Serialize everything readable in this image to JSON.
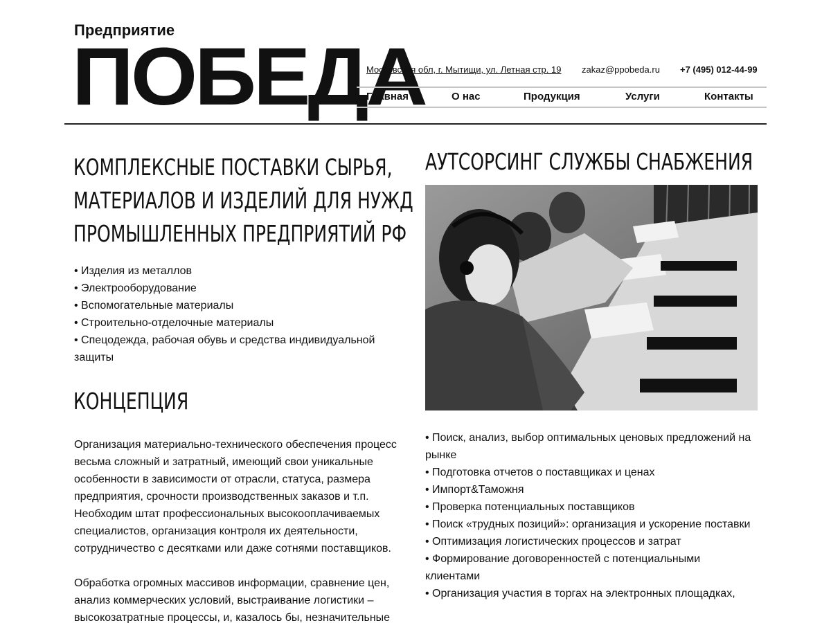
{
  "header": {
    "brand_small": "Предприятие",
    "brand_big": "ПОБЕДА",
    "address": "Московская обл, г. Мытищи, ул. Летная стр. 19",
    "email": "zakaz@ppobeda.ru",
    "phone": "+7 (495) 012-44-99"
  },
  "nav": {
    "items": [
      "Главная",
      "О нас",
      "Продукция",
      "Услуги",
      "Контакты"
    ]
  },
  "hero": {
    "title_lines": [
      "КОМПЛЕКСНЫЕ ПОСТАВКИ СЫРЬЯ,",
      "МАТЕРИАЛОВ И ИЗДЕЛИЙ ДЛЯ НУЖД",
      "ПРОМЫШЛЕННЫХ ПРЕДПРИЯТИЙ РФ"
    ],
    "items": [
      "• Изделия из металлов",
      "• Электрооборудование",
      "• Вспомогательные материалы",
      "• Строительно-отделочные материалы",
      "• Спецодежда, рабочая обувь и средства индивидуальной защиты"
    ]
  },
  "concept": {
    "title": "КОНЦЕПЦИЯ",
    "paragraphs": [
      "Организация материально-технического обеспечения процесс весьма сложный и затратный, имеющий свои уникальные особенности в зависимости от отрасли, статуса, размера предприятия, срочности производственных заказов и т.п. Необходим штат профессиональных высокооплачиваемых специалистов, организация контроля их деятельности, сотрудничество с десятками или даже сотнями поставщиков.",
      "Обработка огромных массивов информации, сравнение цен, анализ коммерческих условий, выстраивание логистики – высокозатратные процессы, и, казалось бы, незначительные"
    ]
  },
  "outsourcing": {
    "title": "АУТСОРСИНГ СЛУЖБЫ СНАБЖЕНИЯ",
    "items": [
      "• Поиск, анализ, выбор оптимальных ценовых предложений на рынке",
      "• Подготовка отчетов о поставщиках и ценах",
      "• Импорт&Таможня",
      "• Проверка потенциальных поставщиков",
      "• Поиск «трудных позиций»: организация и ускорение поставки",
      "• Оптимизация логистических процессов и затрат",
      "• Формирование договоренностей с потенциальными клиентами",
      "• Организация участия в торгах на электронных площадках,"
    ]
  }
}
